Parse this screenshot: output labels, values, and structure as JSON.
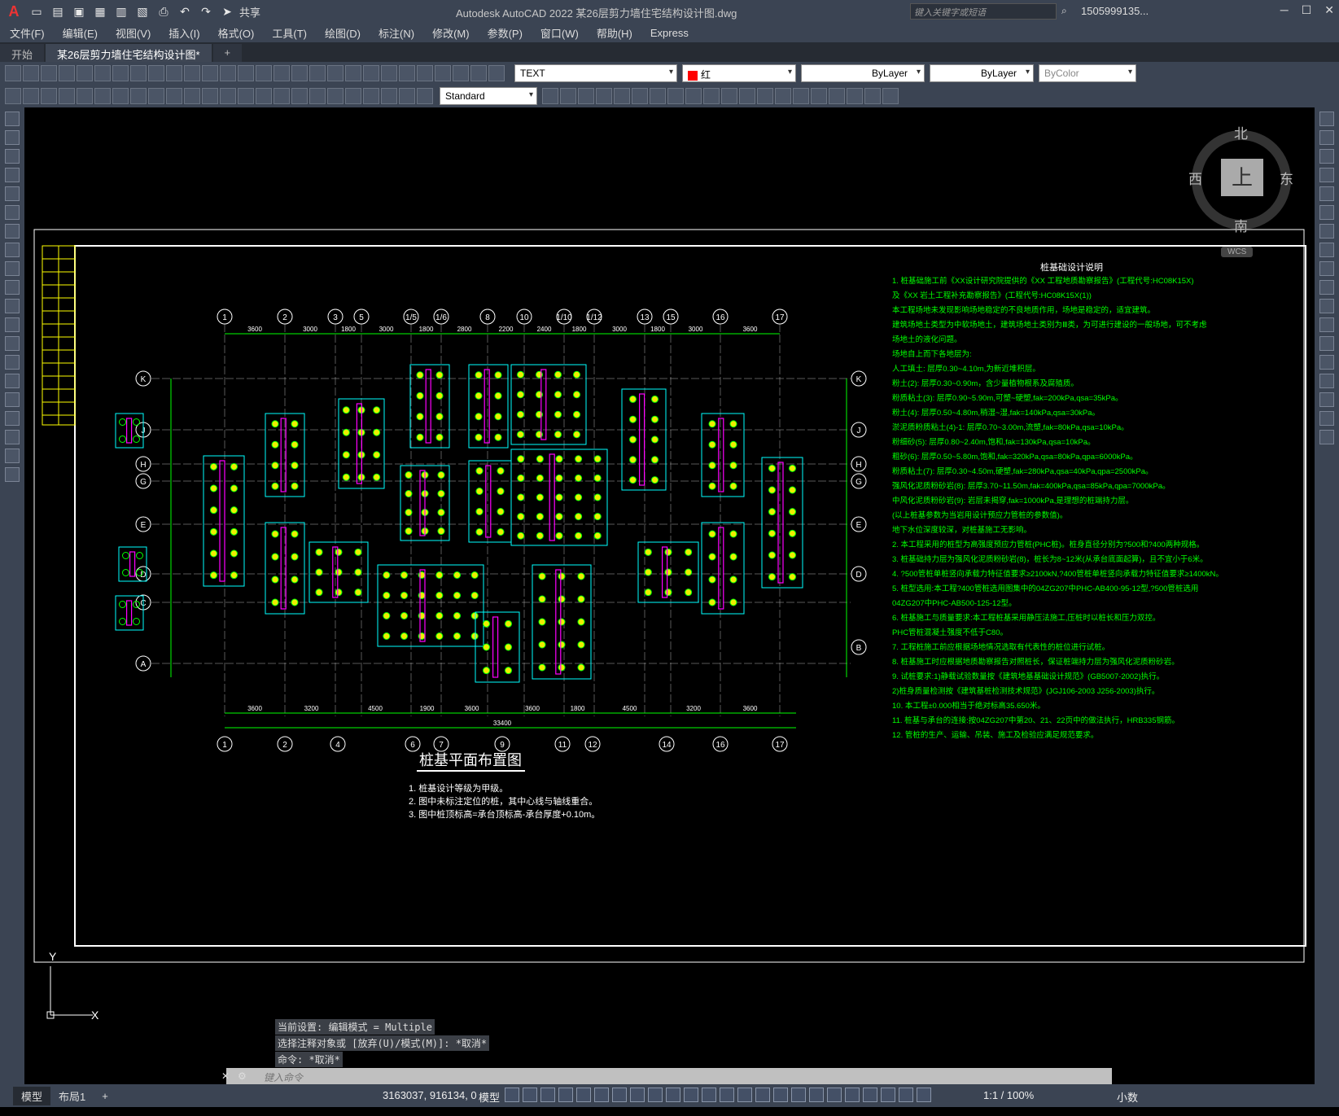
{
  "app": {
    "title": "Autodesk AutoCAD 2022    某26层剪力墙住宅结构设计图.dwg",
    "share": "共享",
    "search_placeholder": "键入关键字或短语",
    "user": "1505999135..."
  },
  "menu": [
    "文件(F)",
    "编辑(E)",
    "视图(V)",
    "插入(I)",
    "格式(O)",
    "工具(T)",
    "绘图(D)",
    "标注(N)",
    "修改(M)",
    "参数(P)",
    "窗口(W)",
    "帮助(H)",
    "Express"
  ],
  "tabs": [
    "开始",
    "某26层剪力墙住宅结构设计图*"
  ],
  "toolbar": {
    "text_style": "TEXT",
    "color": "红",
    "linetype": "ByLayer",
    "lineweight": "ByLayer",
    "plotstyle": "ByColor",
    "dimstyle": "Standard"
  },
  "compass": {
    "n": "北",
    "s": "南",
    "e": "东",
    "w": "西",
    "top": "上",
    "wcs": "WCS"
  },
  "drawing": {
    "title": "桩基平面布置图",
    "notes": [
      "1. 桩基设计等级为甲级。",
      "2. 图中未标注定位的桩，其中心线与轴线重合。",
      "3. 图中桩顶标高=承台顶标高-承台厚度+0.10m。"
    ],
    "grid_top": [
      "1",
      "2",
      "3",
      "5",
      "1/5",
      "1/6",
      "8",
      "10",
      "1/10",
      "1/12",
      "13",
      "15",
      "16",
      "17"
    ],
    "grid_bottom": [
      "1",
      "2",
      "4",
      "6",
      "7",
      "9",
      "11",
      "12",
      "14",
      "16",
      "17"
    ],
    "grid_left": [
      "K",
      "J",
      "H",
      "G",
      "E",
      "D",
      "C",
      "A"
    ],
    "grid_right": [
      "K",
      "J",
      "H",
      "G",
      "E",
      "D",
      "B"
    ],
    "dims_top": [
      "3600",
      "3000",
      "1800",
      "3000",
      "1800",
      "2800",
      "2200",
      "2400",
      "1800",
      "3000",
      "1800",
      "3000",
      "3600"
    ],
    "dims_bottom": [
      "3600",
      "3200",
      "4500",
      "1900",
      "3600",
      "3600",
      "1800",
      "4500",
      "3200",
      "3600"
    ],
    "total_dim": "33400",
    "spec_title": "桩基础设计说明",
    "spec": [
      "1. 桩基础施工前《XX设计研究院提供的《XX 工程地质勘察报告》(工程代号:HC08K15X)",
      "   及《XX 岩土工程补充勘察报告》(工程代号:HC08K15X(1))",
      "   本工程场地未发现影响场地稳定的不良地质作用，场地是稳定的，适宜建筑。",
      "   建筑场地土类型为中软场地土，建筑场地土类别为Ⅲ类，为可进行建设的一般场地，可不考虑",
      "   场地土的液化问题。",
      "   场地自上而下各地层为:",
      "   人工填土: 层厚0.30~4.10m,为新近堆积层。",
      "   粉土(2): 层厚0.30~0.90m，含少量植物根系及腐殖质。",
      "   粉质粘土(3): 层厚0.90~5.90m,可塑~硬塑,fak=200kPa,qsa=35kPa。",
      "   粉土(4): 层厚0.50~4.80m,稍湿~湿,fak=140kPa,qsa=30kPa。",
      "   淤泥质粉质粘土(4)-1: 层厚0.70~3.00m,流塑,fak=80kPa,qsa=10kPa。",
      "   粉细砂(5): 层厚0.80~2.40m,饱和,fak=130kPa,qsa=10kPa。",
      "   粗砂(6): 层厚0.50~5.80m,饱和,fak=320kPa,qsa=80kPa,qpa=6000kPa。",
      "   粉质粘土(7): 层厚0.30~4.50m,硬塑,fak=280kPa,qsa=40kPa,qpa=2500kPa。",
      "   强风化泥质粉砂岩(8): 层厚3.70~11.50m,fak=400kPa,qsa=85kPa,qpa=7000kPa。",
      "   中风化泥质粉砂岩(9): 岩层未揭穿,fak=1000kPa,是理想的桩端持力层。",
      "   (以上桩基参数为当岩用设计预应力管桩的参数值)。",
      "   地下水位深度较深，对桩基施工无影响。",
      "2. 本工程采用的桩型为高强度预应力管桩(PHC桩)。桩身直径分别为?500和?400两种规格。",
      "3. 桩基础持力层为强风化泥质粉砂岩(8)，桩长为8~12米(从承台底面起算)，且不宜小于6米。",
      "4. ?500管桩单桩竖向承载力特征值要求≥2100kN,?400管桩单桩竖向承载力特征值要求≥1400kN。",
      "5. 桩型选用:本工程?400管桩选用图集中的04ZG207中PHC-AB400-95-12型,?500管桩选用",
      "   04ZG207中PHC-AB500-125-12型。",
      "6. 桩基施工与质量要求:本工程桩基采用静压法施工,压桩时以桩长和压力双控。",
      "   PHC管桩混凝土强度不低于C80。",
      "7. 工程桩施工前应根据场地情况选取有代表性的桩位进行试桩。",
      "8. 桩基施工时应根据地质勘察报告对照桩长，保证桩端持力层为强风化泥质粉砂岩。",
      "9. 试桩要求:1)静载试验数量按《建筑地基基础设计规范》(GB5007-2002)执行。",
      "   2)桩身质量检测按《建筑基桩检测技术规范》(JGJ106-2003 J256-2003)执行。",
      "10. 本工程±0.000相当于绝对标高35.650米。",
      "11. 桩基与承台的连接:按04ZG207中第20、21、22页中的做法执行，HRB335钢筋。",
      "12. 管桩的生产、运输、吊装、施工及检验应满足规范要求。"
    ]
  },
  "command": {
    "h1": "当前设置: 编辑模式 = Multiple",
    "h2": "选择注释对象或 [放弃(U)/模式(M)]: *取消*",
    "h3": "命令: *取消*",
    "placeholder": "键入命令"
  },
  "status": {
    "model_tab": "模型",
    "layout_tab": "布局1",
    "coords": "3163037, 916134, 0",
    "model": "模型",
    "scale": "1:1 / 100%",
    "units": "小数"
  }
}
